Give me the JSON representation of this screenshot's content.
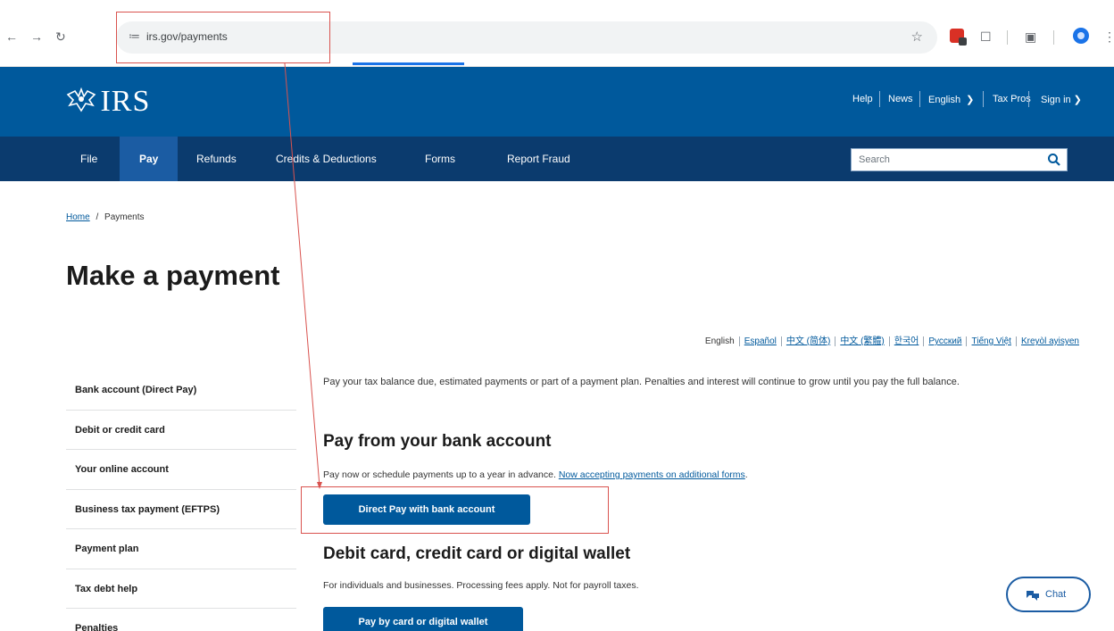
{
  "browser": {
    "url": "irs.gov/payments"
  },
  "header": {
    "logo_text": "IRS",
    "utility": [
      "Help",
      "News",
      "English",
      "Tax Pros",
      "Sign in"
    ]
  },
  "nav": {
    "items": [
      "File",
      "Pay",
      "Refunds",
      "Credits & Deductions",
      "Forms",
      "Report Fraud"
    ],
    "active": "Pay",
    "search_placeholder": "Search"
  },
  "breadcrumb": {
    "home": "Home",
    "sep": "/",
    "current": "Payments"
  },
  "page": {
    "title": "Make a payment"
  },
  "languages": [
    "English",
    "Español",
    "中文 (简体)",
    "中文 (繁體)",
    "한국어",
    "Русский",
    "Tiếng Việt",
    "Kreyòl ayisyen"
  ],
  "sidebar": {
    "items": [
      "Bank account (Direct Pay)",
      "Debit or credit card",
      "Your online account",
      "Business tax payment (EFTPS)",
      "Payment plan",
      "Tax debt help",
      "Penalties"
    ]
  },
  "content": {
    "intro": "Pay your tax balance due, estimated payments or part of a payment plan. Penalties and interest will continue to grow until you pay the full balance.",
    "bank": {
      "heading": "Pay from your bank account",
      "desc": "Pay now or schedule payments up to a year in advance.",
      "link": "Now accepting payments on additional forms",
      "link_suffix": ".",
      "button": "Direct Pay with bank account"
    },
    "card": {
      "heading": "Debit card, credit card or digital wallet",
      "desc": "For individuals and businesses. Processing fees apply. Not for payroll taxes.",
      "button": "Pay by card or digital wallet"
    }
  },
  "chat": {
    "label": "Chat"
  },
  "colors": {
    "header_blue": "#00599c",
    "nav_navy": "#0b3b6e",
    "active_tab": "#1b5ca3",
    "annotation_red": "#d9534f"
  }
}
